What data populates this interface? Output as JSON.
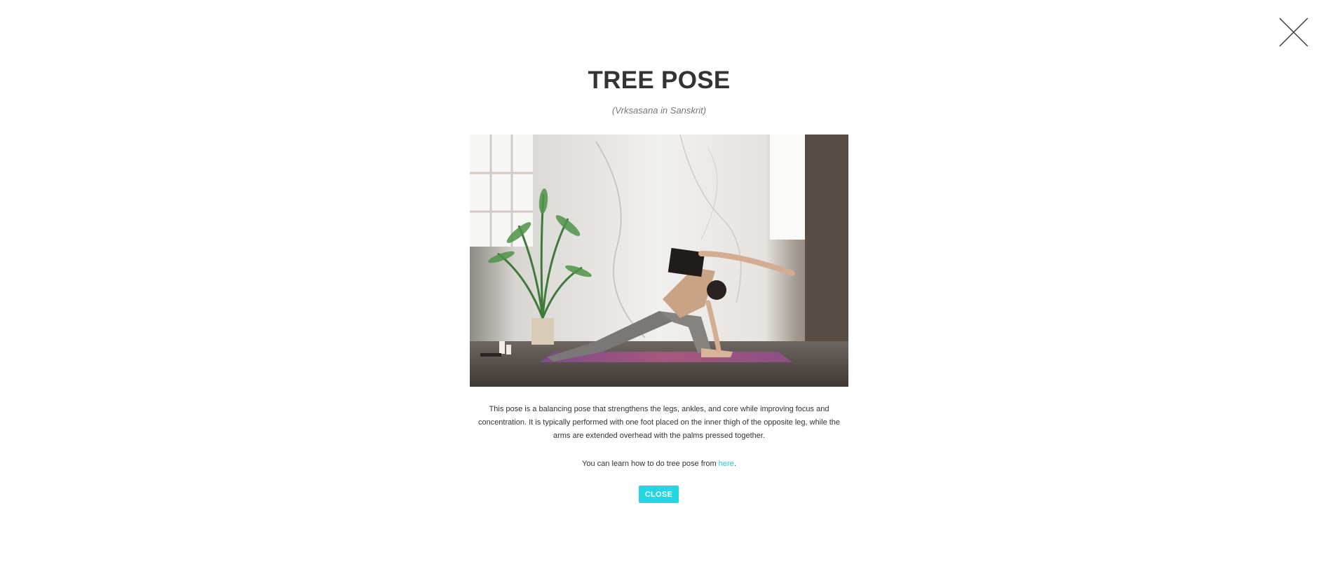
{
  "modal": {
    "title": "TREE POSE",
    "subtitle": "(Vrksasana in Sanskrit)",
    "image_alt": "Woman practicing a yoga pose on a purple mat in a bright studio with a potted palm",
    "description": "This pose is a balancing pose that strengthens the legs, ankles, and core while improving focus and concentration. It is typically performed with one foot placed on the inner thigh of the opposite leg, while the arms are extended overhead with the palms pressed together.",
    "learn_prefix": "You can learn how to do tree pose from ",
    "learn_link": "here",
    "learn_suffix": ".",
    "close_button": "CLOSE"
  },
  "icons": {
    "close": "close-x-icon"
  },
  "colors": {
    "accent": "#22d6e4",
    "link": "#1fc8d6",
    "title": "#333333",
    "subtitle": "#777777"
  }
}
